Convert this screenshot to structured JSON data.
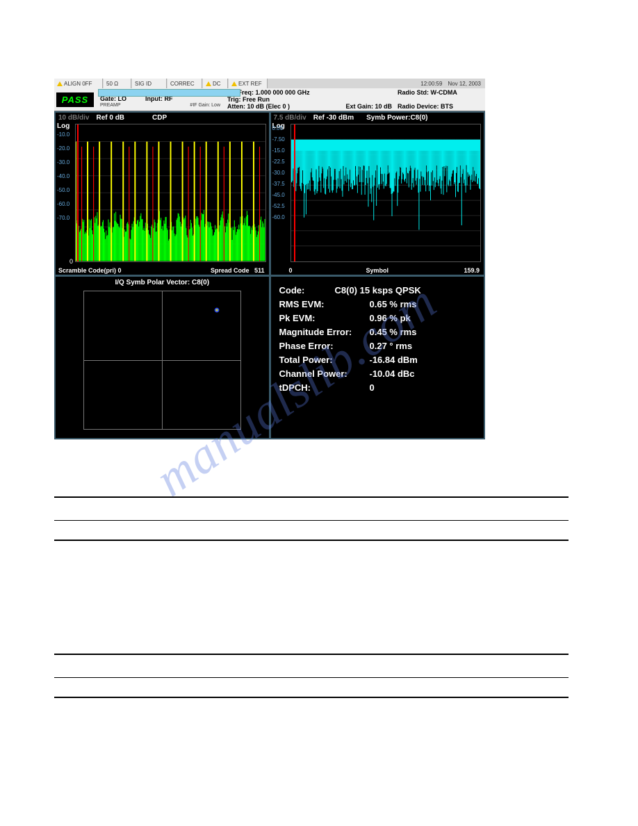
{
  "status_bar": {
    "align": "ALIGN 0FF",
    "impedance": "50 Ω",
    "sig_id": "SIG ID",
    "correc": "CORREC",
    "dc": "DC",
    "ext_ref": "EXT REF",
    "time": "12:00:59",
    "date": "Nov 12, 2003"
  },
  "info": {
    "pass": "PASS",
    "gate": "Gate: LO",
    "preamp": "PREAMP",
    "input": "Input: RF",
    "if_gain": "#IF Gain: Low",
    "ch_freq_label": "CH Freq:",
    "ch_freq": "1.000 000 000 GHz",
    "trig_label": "Trig:",
    "trig": "Free Run",
    "atten_label": "Atten:",
    "atten": "10 dB (Elec 0 )",
    "ext_gain_label": "Ext Gain:",
    "ext_gain": "10 dB",
    "radio_std_label": "Radio Std:",
    "radio_std": "W-CDMA",
    "radio_device_label": "Radio Device:",
    "radio_device": "BTS"
  },
  "cdp": {
    "db_div": "10 dB/div",
    "ref": "Ref 0 dB",
    "title": "CDP",
    "log": "Log",
    "y_ticks": [
      "-10.0",
      "-20.0",
      "-30.0",
      "-40.0",
      "-50.0",
      "-60.0",
      "-70.0"
    ],
    "x_start": "Scramble Code(pri) 0",
    "x_left": "0",
    "x_end_label": "Spread Code",
    "x_end": "511"
  },
  "sym": {
    "db_div": "7.5 dB/div",
    "ref": "Ref -30 dBm",
    "title": "Symb Power:C8(0)",
    "log": "Log",
    "y_ticks": [
      "0.00",
      "-7.50",
      "-15.0",
      "-22.5",
      "-30.0",
      "-37.5",
      "-45.0",
      "-52.5",
      "-60.0"
    ],
    "x_start": "0",
    "x_label": "Symbol",
    "x_end": "159.9"
  },
  "iq": {
    "title": "I/Q Symb Polar Vector: C8(0)"
  },
  "results": {
    "code_label": "Code:",
    "code": "C8(0) 15 ksps QPSK",
    "rms_evm_label": "RMS EVM:",
    "rms_evm": "0.65 % rms",
    "pk_evm_label": "Pk EVM:",
    "pk_evm": "0.96 % pk",
    "mag_err_label": "Magnitude Error:",
    "mag_err": "0.45 % rms",
    "phase_err_label": "Phase Error:",
    "phase_err": "0.27 ° rms",
    "total_pwr_label": "Total Power:",
    "total_pwr": "-16.84 dBm",
    "ch_pwr_label": "Channel Power:",
    "ch_pwr": "-10.04 dBc",
    "tdpch_label": "tDPCH:",
    "tdpch": "0"
  },
  "watermark": "manualslib.com",
  "chart_data": [
    {
      "type": "bar",
      "name": "CDP",
      "xlabel": "Spread Code",
      "ylabel": "dB",
      "xlim": [
        0,
        511
      ],
      "ylim": [
        -80,
        0
      ],
      "annotations": [
        "Scramble Code(pri) 0"
      ],
      "series": [
        {
          "name": "noise-floor",
          "rendering": "green-dense",
          "baseline_db": -55,
          "jitter_db": 8
        }
      ],
      "peaks_db": -10,
      "peak_codes": [
        0,
        32,
        64,
        96,
        128,
        160,
        192,
        224,
        256,
        288,
        320,
        352,
        384,
        416,
        448,
        480
      ],
      "marker_codes": [
        16,
        48,
        144,
        208,
        304,
        336,
        400,
        496
      ]
    },
    {
      "type": "line",
      "name": "Symbol Power",
      "xlabel": "Symbol",
      "ylabel": "dBm",
      "xlim": [
        0,
        159.9
      ],
      "ylim": [
        -67.5,
        0
      ],
      "series": [
        {
          "name": "symb-power",
          "rendering": "cyan-noise",
          "mean_db": -10,
          "min_db": -60,
          "max_db": -7.5
        }
      ],
      "marker_x": 3
    },
    {
      "type": "scatter",
      "name": "I/Q Polar Vector",
      "xlim": [
        -1,
        1
      ],
      "ylim": [
        -1,
        1
      ],
      "points": [
        {
          "i": 0.71,
          "q": 0.71
        }
      ]
    }
  ]
}
